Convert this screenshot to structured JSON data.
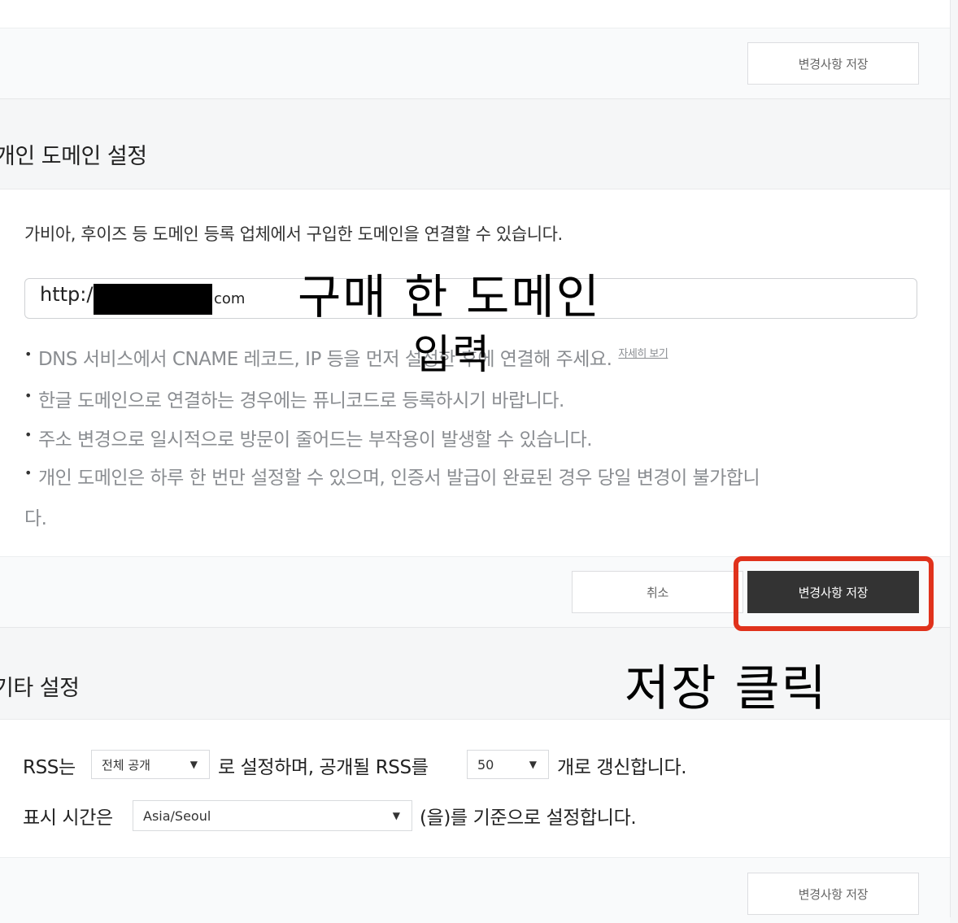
{
  "top_panel": {
    "save_label": "변경사항 저장"
  },
  "domain_section": {
    "title": "개인 도메인 설정",
    "description": "가비아, 후이즈 등 도메인 등록 업체에서 구입한 도메인을 연결할 수 있습니다.",
    "input_prefix": "http:/",
    "input_suffix": "com",
    "notes": [
      {
        "text": "DNS 서비스에서 CNAME 레코드, IP 등을 먼저 설정한 후에 연결해 주세요.",
        "link": "자세히 보기"
      },
      {
        "text": "한글 도메인으로 연결하는 경우에는 퓨니코드로 등록하시기 바랍니다."
      },
      {
        "text": "주소 변경으로 일시적으로 방문이 줄어드는 부작용이 발생할 수 있습니다."
      },
      {
        "text": "개인 도메인은 하루 한 번만 설정할 수 있으며, 인증서 발급이 완료된 경우 당일 변경이 불가합니",
        "continuation": "다."
      }
    ],
    "cancel_label": "취소",
    "save_label": "변경사항 저장"
  },
  "annotations": {
    "domain_hint_line1": "구매 한 도메인",
    "domain_hint_line2": "입력",
    "save_hint": "저장 클릭",
    "highlight_color": "#e0321c"
  },
  "other_section": {
    "title": "기타 설정",
    "rss_prefix": "RSS는",
    "rss_visibility": "전체 공개",
    "rss_middle": "로 설정하며, 공개될 RSS를",
    "rss_count": "50",
    "rss_suffix": "개로 갱신합니다.",
    "time_prefix": "표시 시간은",
    "timezone": "Asia/Seoul",
    "time_suffix": "(을)를 기준으로 설정합니다.",
    "save_label": "변경사항 저장"
  }
}
